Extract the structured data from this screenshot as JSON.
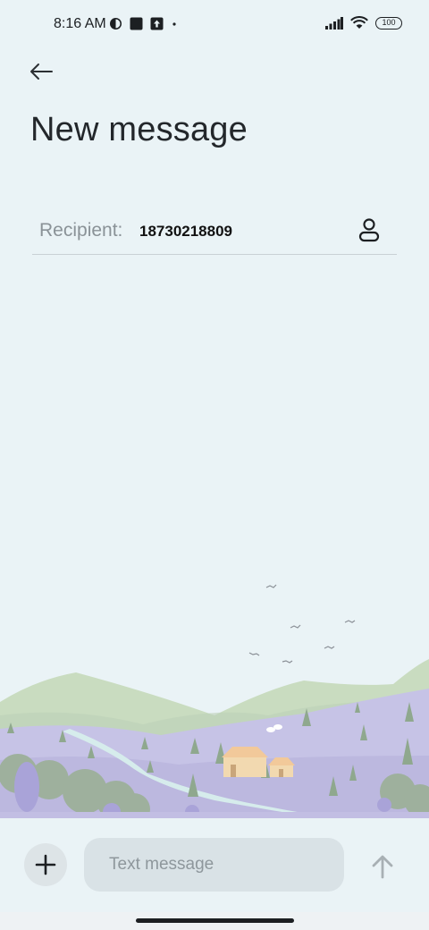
{
  "status_bar": {
    "time": "8:16 AM",
    "battery": "100"
  },
  "header": {
    "title": "New message"
  },
  "recipient": {
    "label": "Recipient:",
    "value": "18730218809"
  },
  "composer": {
    "placeholder": "Text message"
  },
  "icons": {
    "back": "back-arrow-icon",
    "contact": "contact-person-icon",
    "attach": "plus-icon",
    "send": "send-arrow-icon"
  },
  "colors": {
    "background": "#eaf3f6",
    "hill_green": "#c9dcc0",
    "field_purple": "#c6c3e6",
    "tree_green": "#8fa88e",
    "house": "#f2d9b0"
  }
}
